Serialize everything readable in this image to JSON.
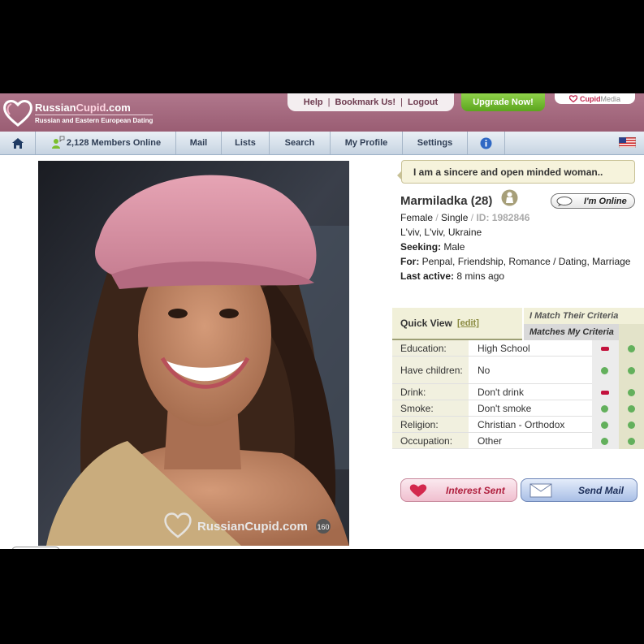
{
  "site": {
    "name_main": "Russian",
    "name_accent": "Cupid",
    "name_suffix": ".com",
    "tagline": "Russian and Eastern European Dating"
  },
  "toplinks": {
    "help": "Help",
    "bookmark": "Bookmark Us!",
    "logout": "Logout",
    "separator": "|",
    "upgrade": "Upgrade Now!",
    "cupidmedia_a": "Cupid",
    "cupidmedia_b": "Media"
  },
  "nav": {
    "home_icon": "home-icon",
    "members_online": "2,128 Members Online",
    "mail": "Mail",
    "lists": "Lists",
    "search": "Search",
    "my_profile": "My Profile",
    "settings": "Settings",
    "info_icon": "info-icon",
    "flag_icon": "us-flag-icon"
  },
  "photo": {
    "watermark": "RussianCupid.com",
    "badge": "160"
  },
  "profile": {
    "headline": "I am a sincere and open minded woman..",
    "name": "Marmiladka (28)",
    "online_label": "I'm Online",
    "gender": "Female",
    "status": "Single",
    "slash": "/",
    "id": "ID: 1982846",
    "location": "L'viv, L'viv, Ukraine",
    "seeking_label": "Seeking:",
    "seeking": "Male",
    "for_label": "For:",
    "for": "Penpal, Friendship, Romance / Dating, Marriage",
    "last_active_label": "Last active:",
    "last_active": "8 mins ago"
  },
  "quick_view": {
    "title": "Quick View",
    "edit": "[edit]",
    "i_match": "I Match Their Criteria",
    "matches_my": "Matches My Criteria",
    "rows": [
      {
        "label": "Education:",
        "value": "High School",
        "i_match": false,
        "matches": true
      },
      {
        "label": "Have children:",
        "value": "No",
        "i_match": true,
        "matches": true
      },
      {
        "label": "Drink:",
        "value": "Don't drink",
        "i_match": false,
        "matches": true
      },
      {
        "label": "Smoke:",
        "value": "Don't smoke",
        "i_match": true,
        "matches": true
      },
      {
        "label": "Religion:",
        "value": "Christian - Orthodox",
        "i_match": true,
        "matches": true
      },
      {
        "label": "Occupation:",
        "value": "Other",
        "i_match": true,
        "matches": true
      }
    ]
  },
  "actions": {
    "interest": "Interest Sent",
    "send_mail": "Send Mail"
  },
  "colors": {
    "header": "#a86a80",
    "match_green": "#63b05c",
    "mismatch_red": "#c3123d"
  }
}
